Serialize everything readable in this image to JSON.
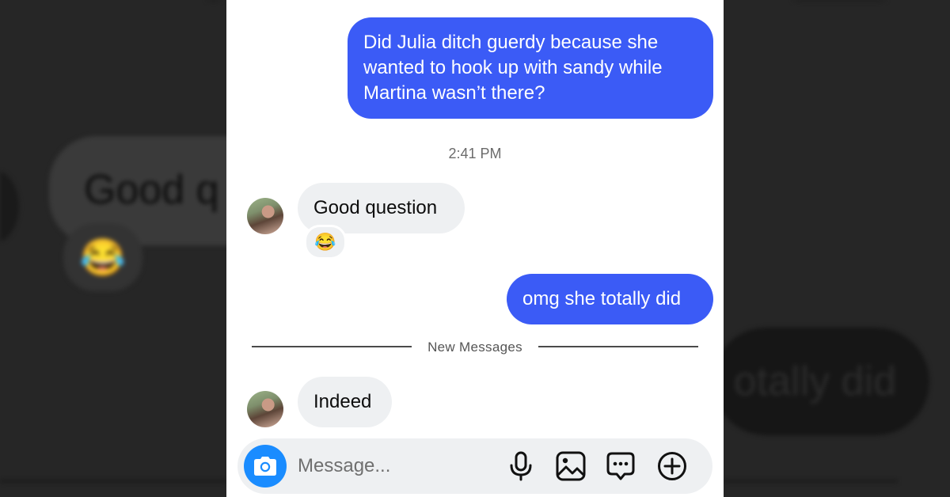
{
  "background": {
    "left_bubble_text": "Good q",
    "right_bubble_text": "otally did",
    "left_emoji": "😂"
  },
  "conversation": {
    "messages": [
      {
        "from": "me",
        "text": "Did Julia ditch guerdy because she wanted to hook up with sandy while Martina wasn’t there?"
      },
      {
        "from": "them",
        "text": "Good question",
        "reaction": "😂"
      },
      {
        "from": "me",
        "text": "omg she totally did"
      },
      {
        "from": "them",
        "text": "Indeed"
      }
    ],
    "timestamp": "2:41 PM",
    "new_messages_label": "New Messages"
  },
  "composer": {
    "placeholder": "Message...",
    "icons": [
      "camera-icon",
      "microphone-icon",
      "image-icon",
      "chat-bubble-icon",
      "plus-circle-icon"
    ]
  },
  "colors": {
    "outgoing_bubble": "#3b5bf6",
    "incoming_bubble": "#eef0f2",
    "camera_button": "#1a8cff"
  }
}
